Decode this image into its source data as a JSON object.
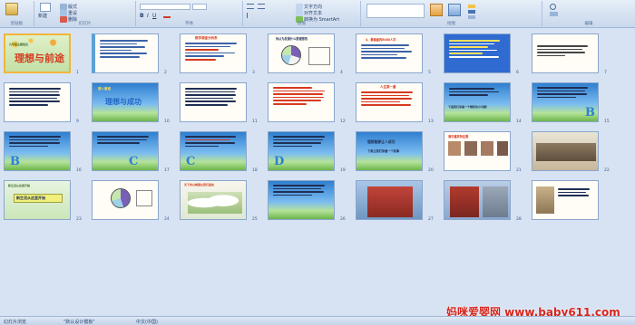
{
  "ribbon": {
    "groups": [
      "剪贴板",
      "幻灯片",
      "字体",
      "段落",
      "绘图",
      "编辑"
    ],
    "buttons": {
      "new_slide": "新建",
      "layout": "版式",
      "reset": "重设",
      "delete": "删除",
      "text_direction": "文字方向",
      "align_text": "对齐文本",
      "smartart": "转换为 SmartArt"
    }
  },
  "slides": {
    "s1": {
      "num": "1",
      "t1": "九年级主题班会",
      "t2": "理想与前途"
    },
    "s2": {
      "num": "2"
    },
    "s3": {
      "num": "3",
      "t1": "数学调查分析表"
    },
    "s4": {
      "num": "4",
      "t1": "你认为发展什么是理想的"
    },
    "s5": {
      "num": "5",
      "t1": "4、最看重的6480人学"
    },
    "s6": {
      "num": "6"
    },
    "s7": {
      "num": "7"
    },
    "s8": {
      "num": "8",
      "t1": "各抒己见：",
      "t2": "理想像什么？"
    },
    "s9": {
      "num": "9"
    },
    "s10": {
      "num": "10",
      "t1": "普入事迹",
      "t2": "理想与成功"
    },
    "s11": {
      "num": "11"
    },
    "s12": {
      "num": "12"
    },
    "s13": {
      "num": "13",
      "t1": "人生第一重"
    },
    "s14": {
      "num": "14",
      "t1": "下面我们来看一个精彩的小问题！"
    },
    "s15": {
      "num": "15",
      "letter": "B"
    },
    "s16": {
      "num": "16",
      "letter": "B"
    },
    "s17": {
      "num": "17",
      "letter": "C"
    },
    "s18": {
      "num": "18",
      "letter": "C"
    },
    "s19": {
      "num": "19",
      "letter": "D"
    },
    "s20": {
      "num": "20",
      "t1": "理想能够让人成功",
      "t2": "下面让我们来看一个故事"
    },
    "s21": {
      "num": "21",
      "t1": "清华嘉宾特征题"
    },
    "s22": {
      "num": "22"
    },
    "s23": {
      "num": "23",
      "t1": "新生活从这里开始",
      "t2": "新生活从这里开始"
    },
    "s24": {
      "num": "24"
    },
    "s25": {
      "num": "25",
      "t1": "天下的山峰都在我们面前"
    },
    "s26": {
      "num": "26"
    },
    "s27": {
      "num": "27"
    },
    "s28": {
      "num": "28"
    }
  },
  "status": {
    "slide_info": "幻灯片浏览",
    "theme": "\"默认设计模板\"",
    "language": "中文(中国)"
  },
  "watermark": "妈咪爱婴网 www.baby611.com",
  "colors": {
    "accent": "#f3b53a",
    "ribbon": "#c9d8ec",
    "title_red": "#d63a1f",
    "title_blue": "#1f66c4"
  }
}
